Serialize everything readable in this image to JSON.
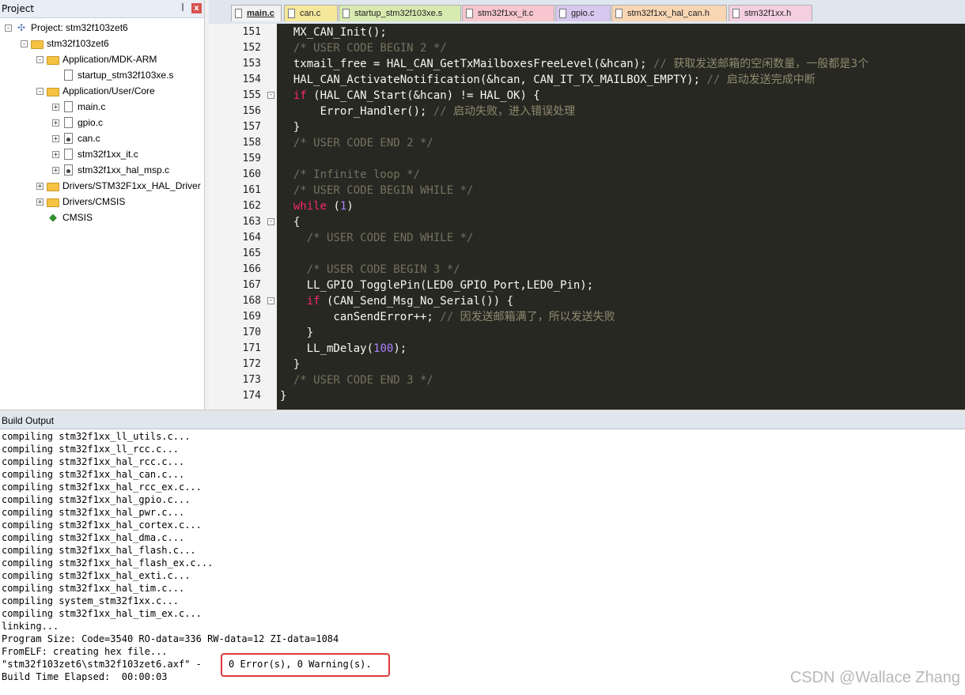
{
  "project_panel": {
    "title": "Project",
    "pin_glyph": "ᵾ",
    "close_glyph": "x",
    "tree": [
      {
        "label": "Project: stm32f103zet6",
        "icon": "project-icon",
        "expander": "-"
      },
      {
        "label": "stm32f103zet6",
        "icon": "target-folder-icon",
        "expander": "-"
      },
      {
        "label": "Application/MDK-ARM",
        "icon": "folder-icon",
        "expander": "-"
      },
      {
        "label": "startup_stm32f103xe.s",
        "icon": "file-icon",
        "expander": ""
      },
      {
        "label": "Application/User/Core",
        "icon": "folder-icon",
        "expander": "-"
      },
      {
        "label": "main.c",
        "icon": "file-icon",
        "expander": "+"
      },
      {
        "label": "gpio.c",
        "icon": "file-icon",
        "expander": "+"
      },
      {
        "label": "can.c",
        "icon": "file-key-icon",
        "expander": "+"
      },
      {
        "label": "stm32f1xx_it.c",
        "icon": "file-icon",
        "expander": "+"
      },
      {
        "label": "stm32f1xx_hal_msp.c",
        "icon": "file-key-icon",
        "expander": "+"
      },
      {
        "label": "Drivers/STM32F1xx_HAL_Driver",
        "icon": "folder-icon",
        "expander": "+"
      },
      {
        "label": "Drivers/CMSIS",
        "icon": "folder-icon",
        "expander": "+"
      },
      {
        "label": "CMSIS",
        "icon": "green-diamond-icon",
        "expander": ""
      }
    ]
  },
  "tabs": [
    {
      "label": "main.c",
      "color": "#f2f2f2",
      "active": true
    },
    {
      "label": "can.c",
      "color": "#f6e89a"
    },
    {
      "label": "startup_stm32f103xe.s",
      "color": "#d7eab0"
    },
    {
      "label": "stm32f1xx_it.c",
      "color": "#f7c6cf"
    },
    {
      "label": "gpio.c",
      "color": "#d6c8ee"
    },
    {
      "label": "stm32f1xx_hal_can.h",
      "color": "#f8d6b4"
    },
    {
      "label": "stm32f1xx.h",
      "color": "#f4cfe0"
    }
  ],
  "editor": {
    "theme_bg": "#272822",
    "lines": [
      {
        "n": "151",
        "fold": ""
      },
      {
        "n": "152",
        "fold": ""
      },
      {
        "n": "153",
        "fold": ""
      },
      {
        "n": "154",
        "fold": ""
      },
      {
        "n": "155",
        "fold": "-"
      },
      {
        "n": "156",
        "fold": ""
      },
      {
        "n": "157",
        "fold": ""
      },
      {
        "n": "158",
        "fold": ""
      },
      {
        "n": "159",
        "fold": ""
      },
      {
        "n": "160",
        "fold": ""
      },
      {
        "n": "161",
        "fold": ""
      },
      {
        "n": "162",
        "fold": ""
      },
      {
        "n": "163",
        "fold": "-"
      },
      {
        "n": "164",
        "fold": ""
      },
      {
        "n": "165",
        "fold": ""
      },
      {
        "n": "166",
        "fold": ""
      },
      {
        "n": "167",
        "fold": ""
      },
      {
        "n": "168",
        "fold": "-"
      },
      {
        "n": "169",
        "fold": ""
      },
      {
        "n": "170",
        "fold": ""
      },
      {
        "n": "171",
        "fold": ""
      },
      {
        "n": "172",
        "fold": ""
      },
      {
        "n": "173",
        "fold": ""
      },
      {
        "n": "174",
        "fold": ""
      }
    ],
    "code": [
      [
        {
          "t": "  MX_CAN_Init();",
          "c": ""
        }
      ],
      [
        {
          "t": "  /* USER CODE BEGIN 2 */",
          "c": "comment"
        }
      ],
      [
        {
          "t": "  txmail_free = HAL_CAN_GetTxMailboxesFreeLevel(&hcan); ",
          "c": ""
        },
        {
          "t": "// ",
          "c": "comment"
        },
        {
          "t": "获取发送邮箱的空闲数量，一般都是3个",
          "c": "cn"
        }
      ],
      [
        {
          "t": "  HAL_CAN_ActivateNotification(&hcan, CAN_IT_TX_MAILBOX_EMPTY); ",
          "c": ""
        },
        {
          "t": "// ",
          "c": "comment"
        },
        {
          "t": "启动发送完成中断",
          "c": "cn"
        }
      ],
      [
        {
          "t": "  ",
          "c": ""
        },
        {
          "t": "if",
          "c": "kw"
        },
        {
          "t": " (HAL_CAN_Start(&hcan) != HAL_OK) {",
          "c": ""
        }
      ],
      [
        {
          "t": "      Error_Handler(); ",
          "c": ""
        },
        {
          "t": "// ",
          "c": "comment"
        },
        {
          "t": "启动失败，进入错误处理",
          "c": "cn"
        }
      ],
      [
        {
          "t": "  }",
          "c": ""
        }
      ],
      [
        {
          "t": "  /* USER CODE END 2 */",
          "c": "comment"
        }
      ],
      [
        {
          "t": "",
          "c": ""
        }
      ],
      [
        {
          "t": "  /* Infinite loop */",
          "c": "comment"
        }
      ],
      [
        {
          "t": "  /* USER CODE BEGIN WHILE */",
          "c": "comment"
        }
      ],
      [
        {
          "t": "  ",
          "c": ""
        },
        {
          "t": "while",
          "c": "kw"
        },
        {
          "t": " (",
          "c": ""
        },
        {
          "t": "1",
          "c": "num"
        },
        {
          "t": ")",
          "c": ""
        }
      ],
      [
        {
          "t": "  {",
          "c": ""
        }
      ],
      [
        {
          "t": "    /* USER CODE END WHILE */",
          "c": "comment"
        }
      ],
      [
        {
          "t": "",
          "c": ""
        }
      ],
      [
        {
          "t": "    /* USER CODE BEGIN 3 */",
          "c": "comment"
        }
      ],
      [
        {
          "t": "    LL_GPIO_TogglePin(LED0_GPIO_Port,LED0_Pin);",
          "c": ""
        }
      ],
      [
        {
          "t": "    ",
          "c": ""
        },
        {
          "t": "if",
          "c": "kw"
        },
        {
          "t": " (CAN_Send_Msg_No_Serial()) {",
          "c": ""
        }
      ],
      [
        {
          "t": "        canSendError++; ",
          "c": ""
        },
        {
          "t": "// ",
          "c": "comment"
        },
        {
          "t": "因发送邮箱满了，所以发送失败",
          "c": "cn"
        }
      ],
      [
        {
          "t": "    }",
          "c": ""
        }
      ],
      [
        {
          "t": "    LL_mDelay(",
          "c": ""
        },
        {
          "t": "100",
          "c": "num"
        },
        {
          "t": ");",
          "c": ""
        }
      ],
      [
        {
          "t": "  }",
          "c": ""
        }
      ],
      [
        {
          "t": "  /* USER CODE END 3 */",
          "c": "comment"
        }
      ],
      [
        {
          "t": "}",
          "c": ""
        }
      ]
    ]
  },
  "build_output": {
    "title": "Build Output",
    "lines": [
      "compiling stm32f1xx_ll_utils.c...",
      "compiling stm32f1xx_ll_rcc.c...",
      "compiling stm32f1xx_hal_rcc.c...",
      "compiling stm32f1xx_hal_can.c...",
      "compiling stm32f1xx_hal_rcc_ex.c...",
      "compiling stm32f1xx_hal_gpio.c...",
      "compiling stm32f1xx_hal_pwr.c...",
      "compiling stm32f1xx_hal_cortex.c...",
      "compiling stm32f1xx_hal_dma.c...",
      "compiling stm32f1xx_hal_flash.c...",
      "compiling stm32f1xx_hal_flash_ex.c...",
      "compiling stm32f1xx_hal_exti.c...",
      "compiling stm32f1xx_hal_tim.c...",
      "compiling system_stm32f1xx.c...",
      "compiling stm32f1xx_hal_tim_ex.c...",
      "linking...",
      "Program Size: Code=3540 RO-data=336 RW-data=12 ZI-data=1084",
      "FromELF: creating hex file...",
      "\"stm32f103zet6\\stm32f103zet6.axf\" -",
      "Build Time Elapsed:  00:00:03"
    ],
    "result": "0 Error(s), 0 Warning(s).",
    "highlight_color": "#e03a3a"
  },
  "watermark": "CSDN @Wallace Zhang"
}
